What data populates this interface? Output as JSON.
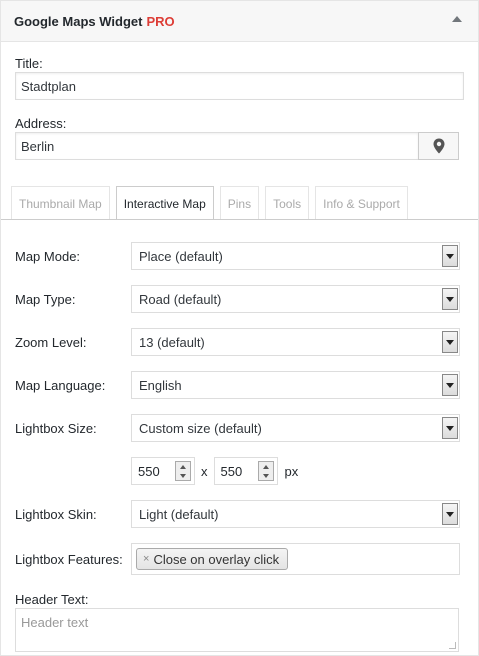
{
  "widget": {
    "title": "Google Maps Widget",
    "badge": "PRO",
    "badge_color": "#dd3d36",
    "toggle_icon": "triangle-up-icon"
  },
  "fields": {
    "title_label": "Title:",
    "title_value": "Stadtplan",
    "address_label": "Address:",
    "address_value": "Berlin",
    "pin_icon": "map-pin-icon"
  },
  "tabs": [
    {
      "label": "Thumbnail Map",
      "active": false
    },
    {
      "label": "Interactive Map",
      "active": true
    },
    {
      "label": "Pins",
      "active": false
    },
    {
      "label": "Tools",
      "active": false
    },
    {
      "label": "Info & Support",
      "active": false
    }
  ],
  "settings": {
    "map_mode": {
      "label": "Map Mode:",
      "value": "Place (default)"
    },
    "map_type": {
      "label": "Map Type:",
      "value": "Road (default)"
    },
    "zoom_level": {
      "label": "Zoom Level:",
      "value": "13 (default)"
    },
    "map_language": {
      "label": "Map Language:",
      "value": "English"
    },
    "lightbox_size": {
      "label": "Lightbox Size:",
      "value": "Custom size (default)"
    },
    "lightbox_width": "550",
    "lightbox_height": "550",
    "size_separator": "x",
    "size_unit": "px",
    "lightbox_skin": {
      "label": "Lightbox Skin:",
      "value": "Light (default)"
    },
    "lightbox_features": {
      "label": "Lightbox Features:",
      "chip_x": "×",
      "chip_label": "Close on overlay click"
    },
    "header_text": {
      "label": "Header Text:",
      "placeholder": "Header text"
    }
  }
}
